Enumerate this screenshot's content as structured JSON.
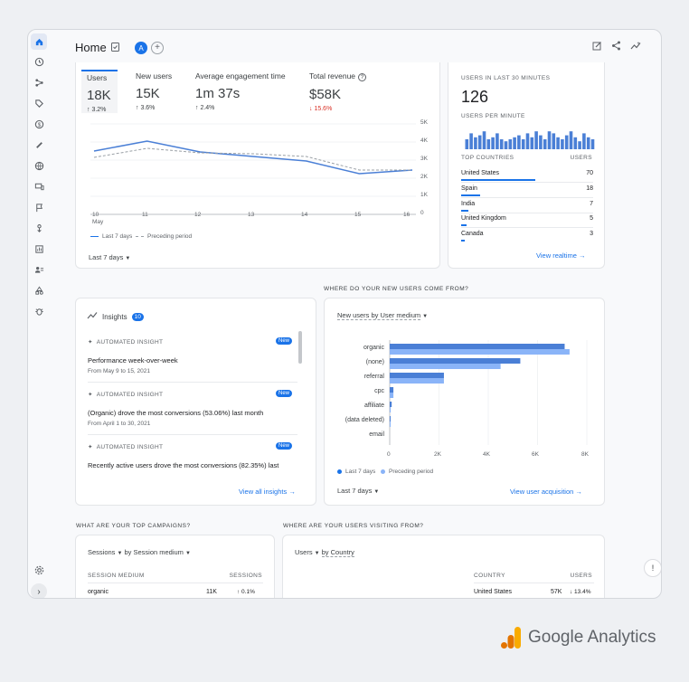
{
  "header": {
    "title": "Home",
    "avatar_letter": "A",
    "add_label": "+"
  },
  "metrics": [
    {
      "label": "Users",
      "value": "18K",
      "change": "↑ 3.2%"
    },
    {
      "label": "New users",
      "value": "15K",
      "change": "↑ 3.6%"
    },
    {
      "label": "Average engagement time",
      "value": "1m 37s",
      "change": "↑ 2.4%"
    },
    {
      "label": "Total revenue",
      "value": "$58K",
      "change": "↓ 15.6%"
    }
  ],
  "overview_chart": {
    "y_ticks": [
      "5K",
      "4K",
      "3K",
      "2K",
      "1K",
      "0"
    ],
    "x_ticks": [
      "10",
      "11",
      "12",
      "13",
      "14",
      "15",
      "16"
    ],
    "x_month": "May",
    "legend_current": "Last 7 days",
    "legend_previous": "Preceding period",
    "range_label": "Last 7 days"
  },
  "realtime": {
    "heading": "USERS IN LAST 30 MINUTES",
    "value": "126",
    "per_minute_heading": "USERS PER MINUTE",
    "col_country": "TOP COUNTRIES",
    "col_users": "USERS",
    "rows": [
      {
        "country": "United States",
        "users": "70"
      },
      {
        "country": "Spain",
        "users": "18"
      },
      {
        "country": "India",
        "users": "7"
      },
      {
        "country": "United Kingdom",
        "users": "5"
      },
      {
        "country": "Canada",
        "users": "3"
      }
    ],
    "link": "View realtime"
  },
  "insights": {
    "title": "Insights",
    "count": "10",
    "items": [
      {
        "kind": "AUTOMATED INSIGHT",
        "badge": "New",
        "title": "Performance week-over-week",
        "date": "From May 9 to 15, 2021"
      },
      {
        "kind": "AUTOMATED INSIGHT",
        "badge": "New",
        "title": "(Organic) drove the most conversions (53.06%) last month",
        "date": "From April 1 to 30, 2021"
      },
      {
        "kind": "AUTOMATED INSIGHT",
        "badge": "New",
        "title": "Recently active users drove the most conversions (82.35%) last",
        "date": ""
      }
    ],
    "link": "View all insights"
  },
  "acquisition": {
    "section_heading": "WHERE DO YOUR NEW USERS COME FROM?",
    "dropdown": "New users by User medium",
    "legend_current": "Last 7 days",
    "legend_previous": "Preceding period",
    "range_label": "Last 7 days",
    "link": "View user acquisition",
    "x_ticks": [
      "0",
      "2K",
      "4K",
      "6K",
      "8K"
    ]
  },
  "campaigns": {
    "section_heading": "WHAT ARE YOUR TOP CAMPAIGNS?",
    "metric_dropdown": "Sessions",
    "by_dropdown": "by Session medium",
    "col_dim": "SESSION MEDIUM",
    "col_metric": "SESSIONS",
    "rows": [
      {
        "name": "organic",
        "value": "11K",
        "change": "↑ 0.1%"
      }
    ]
  },
  "countries": {
    "section_heading": "WHERE ARE YOUR USERS VISITING FROM?",
    "metric_dropdown": "Users",
    "by_dropdown": "by Country",
    "col_dim": "COUNTRY",
    "col_metric": "USERS",
    "rows": [
      {
        "name": "United States",
        "value": "57K",
        "change": "↓ 13.4%"
      }
    ]
  },
  "brand": {
    "name": "Google Analytics"
  },
  "chart_data": [
    {
      "type": "line",
      "x": [
        "10",
        "11",
        "12",
        "13",
        "14",
        "15",
        "16"
      ],
      "series": [
        {
          "name": "Last 7 days",
          "values": [
            3500,
            4050,
            3450,
            3200,
            2950,
            2250,
            2450
          ]
        },
        {
          "name": "Preceding period",
          "values": [
            3150,
            3650,
            3400,
            3350,
            3200,
            2450,
            2450
          ]
        }
      ],
      "ylim": [
        0,
        5000
      ]
    },
    {
      "type": "bar",
      "categories": [
        "organic",
        "(none)",
        "referral",
        "cpc",
        "affiliate",
        "(data deleted)",
        "email"
      ],
      "series": [
        {
          "name": "Last 7 days",
          "values": [
            7100,
            5300,
            2200,
            150,
            80,
            10,
            0
          ]
        },
        {
          "name": "Preceding period",
          "values": [
            7300,
            4500,
            2200,
            150,
            40,
            10,
            0
          ]
        }
      ],
      "xlim": [
        0,
        8000
      ]
    },
    {
      "type": "bar",
      "categories": [
        "1",
        "2",
        "3",
        "4",
        "5",
        "6",
        "7",
        "8",
        "9",
        "10",
        "11",
        "12",
        "13",
        "14",
        "15",
        "16",
        "17",
        "18",
        "19",
        "20",
        "21",
        "22",
        "23",
        "24",
        "25",
        "26",
        "27",
        "28",
        "29",
        "30"
      ],
      "values": [
        5,
        8,
        6,
        7,
        9,
        5,
        6,
        8,
        5,
        4,
        5,
        6,
        7,
        5,
        8,
        6,
        9,
        7,
        5,
        9,
        8,
        6,
        5,
        7,
        9,
        6,
        4,
        8,
        6,
        5
      ]
    }
  ]
}
